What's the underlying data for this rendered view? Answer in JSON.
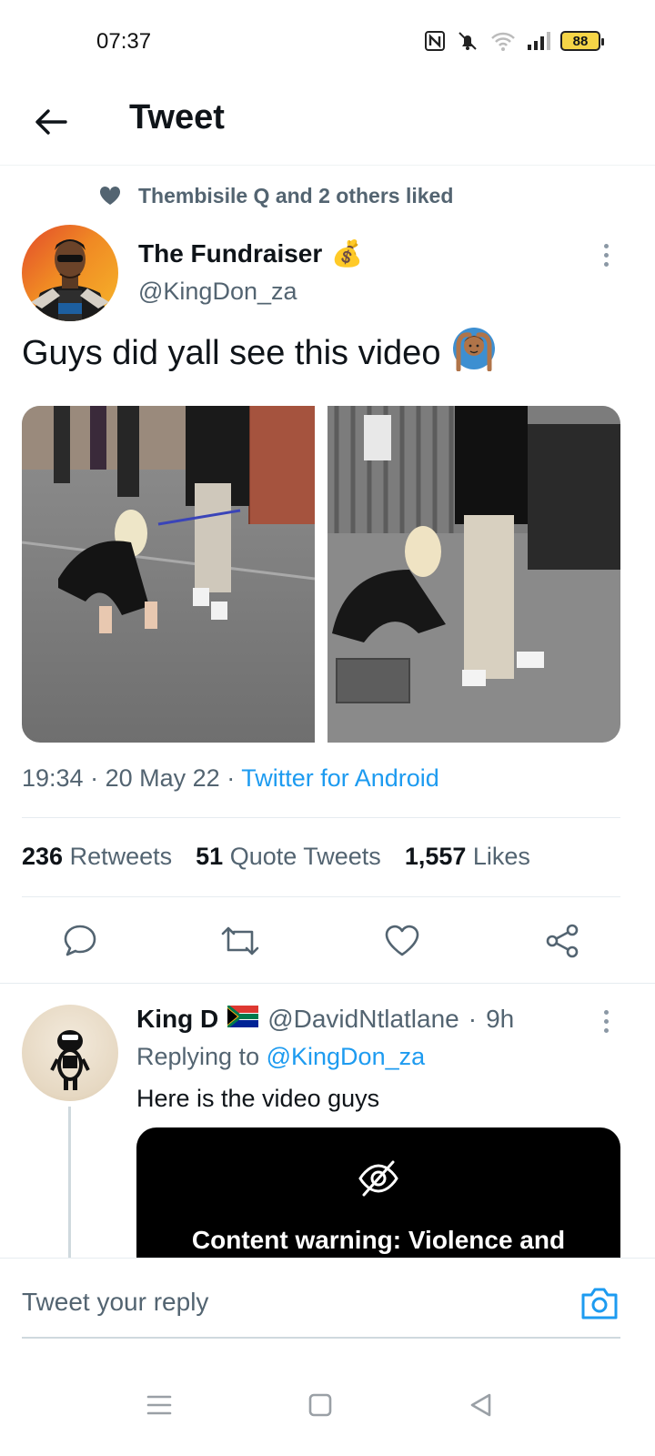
{
  "status_bar": {
    "time": "07:37",
    "battery": "88",
    "icons": [
      "nfc-icon",
      "mute-icon",
      "wifi-icon",
      "signal-icon",
      "battery-icon"
    ]
  },
  "header": {
    "title": "Tweet",
    "back_icon": "arrow-left-icon"
  },
  "social_context": {
    "text": "Thembisile Q and 2 others liked",
    "icon": "heart-filled-icon"
  },
  "tweet": {
    "author_name": "The Fundraiser",
    "author_emoji": "💰",
    "author_handle": "@KingDon_za",
    "text": "Guys did yall see this video",
    "text_emoji": "🙆🏽‍♂️",
    "time": "19:34",
    "date": "20 May 22",
    "source": "Twitter for Android",
    "retweets": "236",
    "retweets_label": "Retweets",
    "quotes": "51",
    "quotes_label": "Quote Tweets",
    "likes": "1,557",
    "likes_label": "Likes"
  },
  "reply": {
    "name": "King D",
    "flag": "🇿🇦",
    "handle": "@DavidNtlatlane",
    "age": "9h",
    "replying_prefix": "Replying to",
    "replying_to": "@KingDon_za",
    "text": "Here is the video guys",
    "warning": "Content warning: Violence and"
  },
  "composer": {
    "placeholder": "Tweet your reply",
    "camera_icon": "camera-icon"
  },
  "navbar": {
    "icons": [
      "menu-icon",
      "home-square-icon",
      "back-triangle-icon"
    ]
  },
  "colors": {
    "accent": "#1d9bf0",
    "secondary_text": "#536471",
    "primary_text": "#0f1419"
  }
}
